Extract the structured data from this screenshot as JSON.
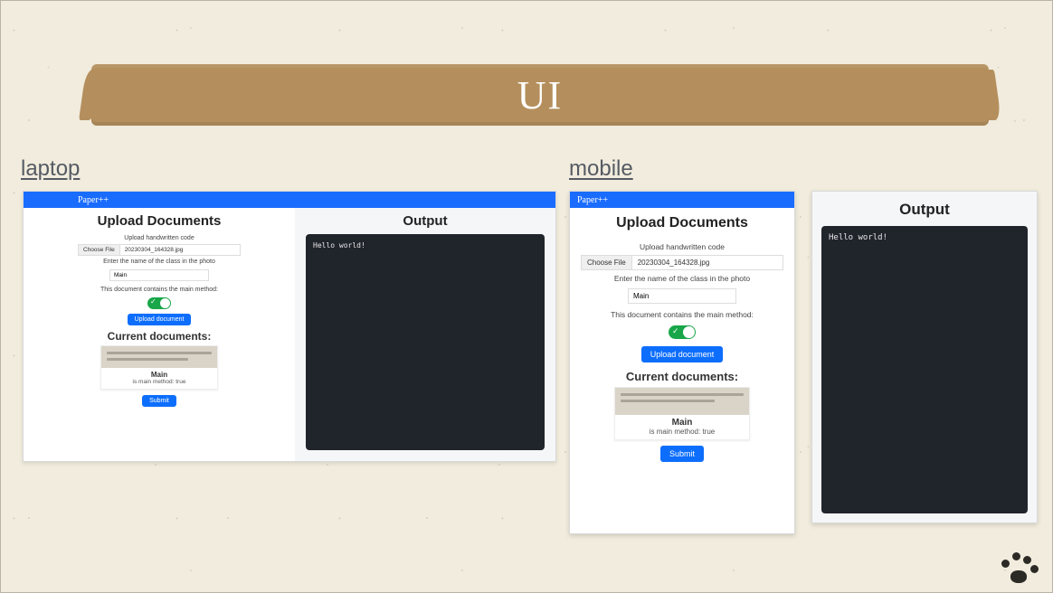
{
  "slide": {
    "title": "UI",
    "labels": {
      "laptop": "laptop",
      "mobile": "mobile"
    }
  },
  "laptop": {
    "brand": "Paper++",
    "upload": {
      "heading": "Upload Documents",
      "subheading": "Upload handwritten code",
      "choose_file_label": "Choose File",
      "chosen_file": "20230304_164328.jpg",
      "class_name_label": "Enter the name of the class in the photo",
      "class_name_value": "Main",
      "main_method_label": "This document contains the main method:",
      "toggle_on": true,
      "upload_button": "Upload document",
      "current_heading": "Current documents:",
      "doc": {
        "name": "Main",
        "meta": "is main method: true"
      },
      "submit_button": "Submit"
    },
    "output": {
      "heading": "Output",
      "terminal_text": "Hello world!"
    }
  },
  "mobile": {
    "brand": "Paper++",
    "upload": {
      "heading": "Upload Documents",
      "subheading": "Upload handwritten code",
      "choose_file_label": "Choose File",
      "chosen_file": "20230304_164328.jpg",
      "class_name_label": "Enter the name of the class in the photo",
      "class_name_value": "Main",
      "main_method_label": "This document contains the main method:",
      "toggle_on": true,
      "upload_button": "Upload document",
      "current_heading": "Current documents:",
      "doc": {
        "name": "Main",
        "meta": "is main method: true"
      },
      "submit_button": "Submit"
    },
    "output": {
      "heading": "Output",
      "terminal_text": "Hello world!"
    }
  }
}
